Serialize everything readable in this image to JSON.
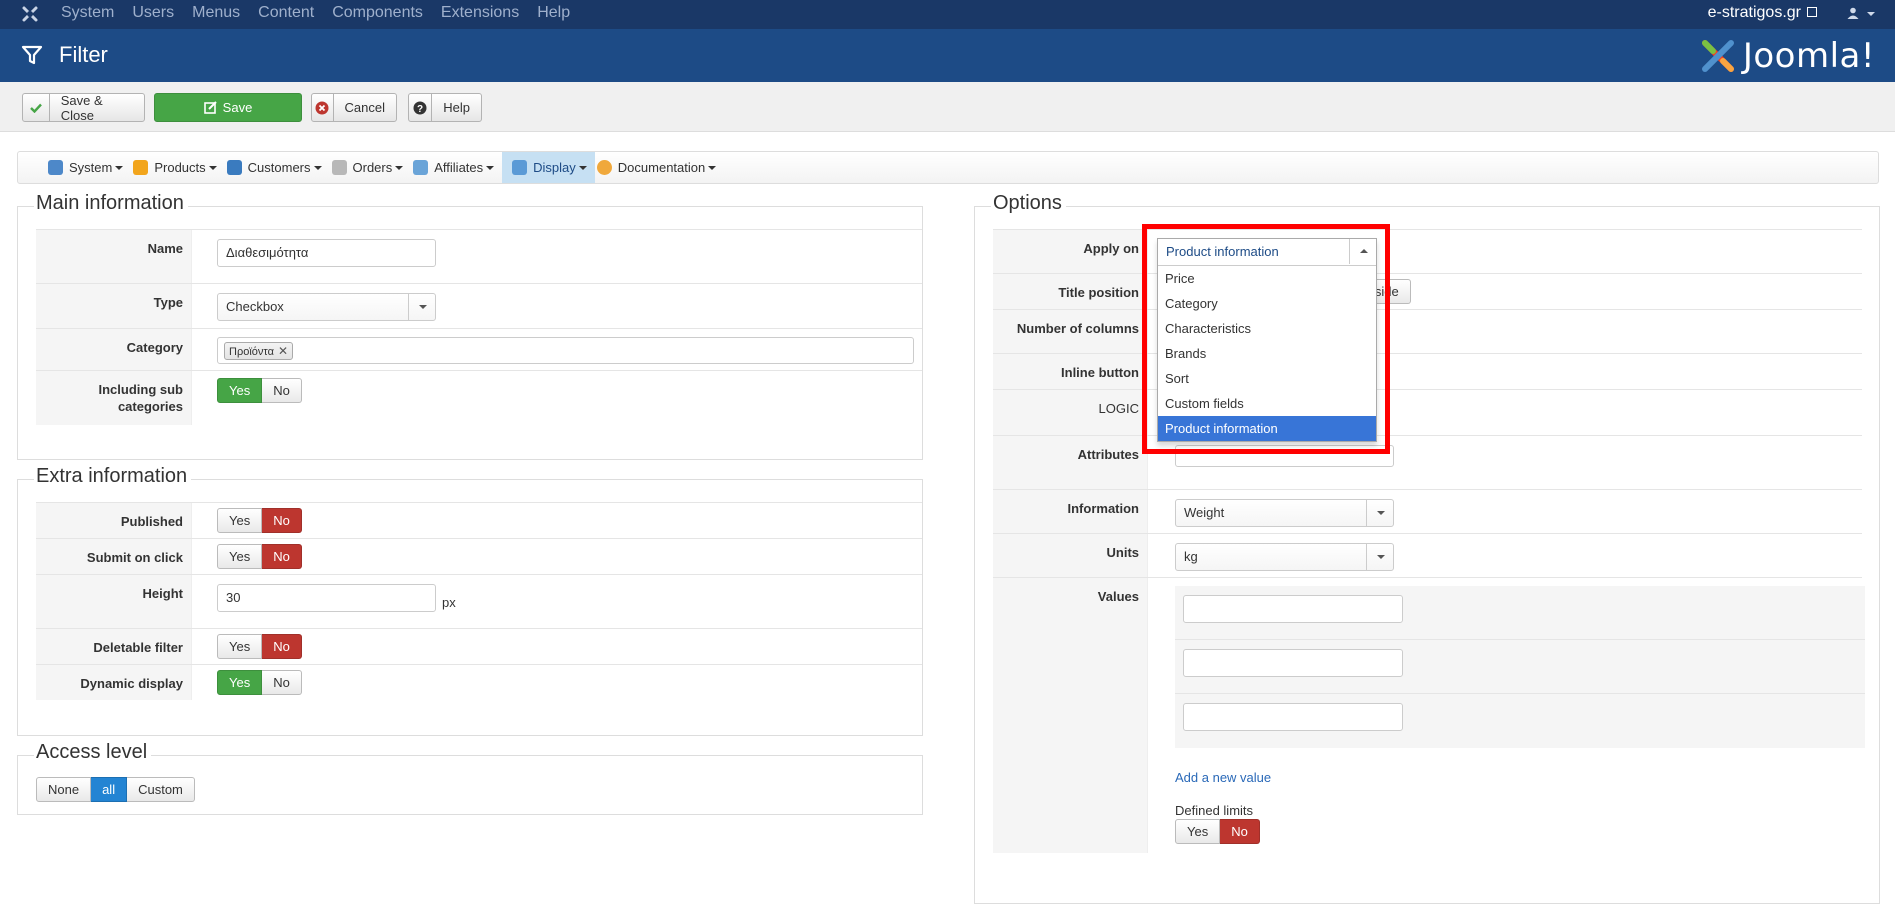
{
  "topbar": {
    "menu": [
      "System",
      "Users",
      "Menus",
      "Content",
      "Components",
      "Extensions",
      "Help"
    ],
    "site": "e-stratigos.gr"
  },
  "header": {
    "title": "Filter",
    "brand": "Joomla!"
  },
  "toolbar": {
    "save_close": "Save & Close",
    "save": "Save",
    "cancel": "Cancel",
    "help": "Help"
  },
  "compmenu": {
    "items": [
      {
        "label": "System",
        "icon": "tools-icon"
      },
      {
        "label": "Products",
        "icon": "box-icon"
      },
      {
        "label": "Customers",
        "icon": "users-icon"
      },
      {
        "label": "Orders",
        "icon": "orders-icon"
      },
      {
        "label": "Affiliates",
        "icon": "affiliates-icon"
      },
      {
        "label": "Display",
        "icon": "display-icon"
      },
      {
        "label": "Documentation",
        "icon": "docs-icon"
      }
    ]
  },
  "main": {
    "legend": "Main information",
    "name_label": "Name",
    "name_value": "Διαθεσιμότητα",
    "type_label": "Type",
    "type_value": "Checkbox",
    "category_label": "Category",
    "category_tag": "Προϊόντα",
    "subcat_label": "Including sub categories",
    "yes": "Yes",
    "no": "No"
  },
  "extra": {
    "legend": "Extra information",
    "published_label": "Published",
    "submit_label": "Submit on click",
    "height_label": "Height",
    "height_value": "30",
    "height_unit": "px",
    "deletable_label": "Deletable filter",
    "dynamic_label": "Dynamic display",
    "yes": "Yes",
    "no": "No"
  },
  "access": {
    "legend": "Access level",
    "none": "None",
    "all": "all",
    "custom": "Custom"
  },
  "options": {
    "legend": "Options",
    "apply_label": "Apply on",
    "apply_value": "Product information",
    "apply_options": [
      "Price",
      "Category",
      "Characteristics",
      "Brands",
      "Sort",
      "Custom fields",
      "Product information"
    ],
    "title_position_label": "Title position",
    "title_position_value": "Inside",
    "columns_label": "Number of columns",
    "inline_label": "Inline button",
    "logic_label": "LOGIC",
    "attributes_label": "Attributes",
    "information_label": "Information",
    "information_value": "Weight",
    "units_label": "Units",
    "units_value": "kg",
    "values_label": "Values",
    "add_value": "Add a new value",
    "defined_limits": "Defined limits",
    "yes": "Yes",
    "no": "No"
  },
  "colors": {
    "topbar": "#1a3867",
    "header": "#1d4b86",
    "green": "#46a546",
    "red": "#bd362f",
    "blue": "#2384d3",
    "highlight": "#ff0000"
  }
}
